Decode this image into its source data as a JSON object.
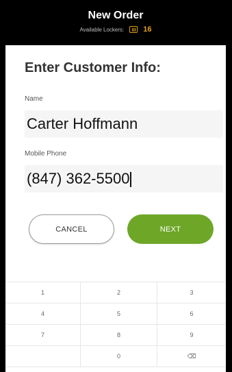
{
  "header": {
    "title": "New Order",
    "available_label": "Available Lockers:",
    "available_count": "16",
    "accent_color": "#e3a11a"
  },
  "form": {
    "section_title": "Enter Customer Info:",
    "name_label": "Name",
    "name_value": "Carter Hoffmann",
    "phone_label": "Mobile Phone",
    "phone_value": "(847) 362-5500"
  },
  "buttons": {
    "cancel_label": "CANCEL",
    "next_label": "NEXT",
    "next_color": "#6ea728"
  },
  "keypad": {
    "keys": [
      "1",
      "2",
      "3",
      "4",
      "5",
      "6",
      "7",
      "8",
      "9",
      "",
      "0",
      "⌫"
    ]
  }
}
